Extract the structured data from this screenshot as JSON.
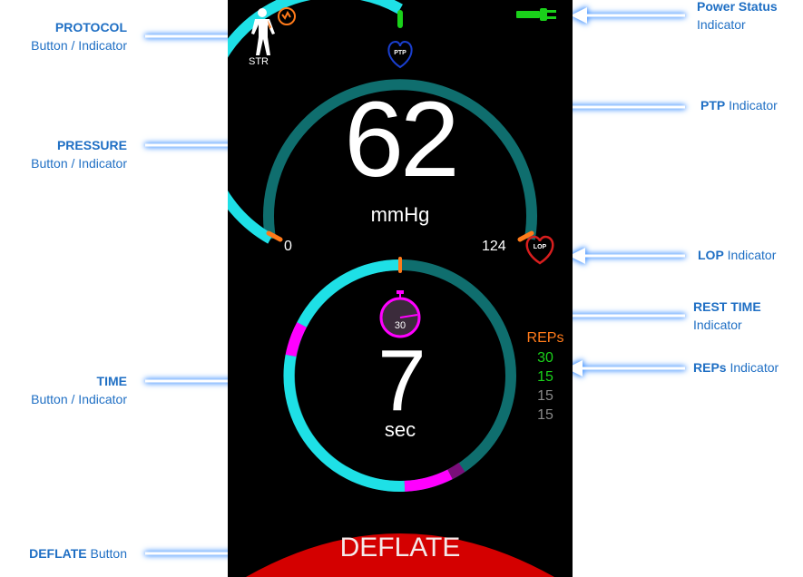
{
  "callouts": {
    "protocol": {
      "key": "PROTOCOL",
      "rest": "Button / Indicator"
    },
    "pressure": {
      "key": "PRESSURE",
      "rest": "Button / Indicator"
    },
    "time": {
      "key": "TIME",
      "rest": "Button / Indicator"
    },
    "deflate": {
      "key": "DEFLATE",
      "rest": " Button"
    },
    "power": {
      "key": "Power Status",
      "rest": "Indicator"
    },
    "ptp": {
      "key": "PTP",
      "rest": " Indicator"
    },
    "lop": {
      "key": "LOP",
      "rest": " Indicator"
    },
    "rest_time": {
      "key": "REST TIME",
      "rest": "Indicator"
    },
    "reps": {
      "key": "REPs",
      "rest": " Indicator"
    }
  },
  "device": {
    "protocol_label": "STR",
    "ptp_label": "PTP",
    "lop_label": "LOP",
    "pressure_value": "62",
    "pressure_unit": "mmHg",
    "scale_min": "0",
    "scale_max": "124",
    "rest_time_value": "30",
    "time_value": "7",
    "time_unit": "sec",
    "reps_title": "REPs",
    "reps": [
      "30",
      "15",
      "15",
      "15"
    ],
    "deflate_label": "DEFLATE"
  },
  "colors": {
    "accent_cyan": "#1ee0e6",
    "track_teal": "#0f6e6e",
    "magenta": "#ff00ff",
    "orange": "#ff7a1a",
    "green": "#1ad11a",
    "deflate_red": "#d40000",
    "callout_blue": "#1f6fc4"
  }
}
